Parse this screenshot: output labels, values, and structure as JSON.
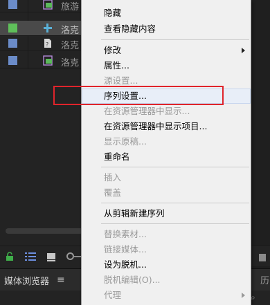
{
  "project_rows": [
    {
      "label": "旅游",
      "swatch": "#6b8cc9",
      "type": "sequence"
    },
    {
      "label": "洛克",
      "swatch": "#5fbf5a",
      "type": "multicam",
      "selected": true
    },
    {
      "label": "洛克",
      "swatch": "#6b8cc9",
      "type": "file"
    },
    {
      "label": "洛克",
      "swatch": "#6b8cc9",
      "type": "sequence"
    }
  ],
  "context_menu": {
    "items": [
      {
        "label": "隐藏",
        "enabled": true
      },
      {
        "label": "查看隐藏内容",
        "enabled": true
      },
      {
        "label": "修改",
        "enabled": true,
        "submenu": true
      },
      {
        "label": "属性...",
        "enabled": true
      },
      {
        "label": "源设置...",
        "enabled": false
      },
      {
        "label": "序列设置...",
        "enabled": true,
        "highlighted": true
      },
      {
        "label": "在资源管理器中显示...",
        "enabled": false
      },
      {
        "label": "在资源管理器中显示项目...",
        "enabled": true
      },
      {
        "label": "显示原稿...",
        "enabled": false
      },
      {
        "label": "重命名",
        "enabled": true
      },
      {
        "label": "插入",
        "enabled": false
      },
      {
        "label": "覆盖",
        "enabled": false
      },
      {
        "label": "从剪辑新建序列",
        "enabled": true
      },
      {
        "label": "替换素材...",
        "enabled": false
      },
      {
        "label": "链接媒体...",
        "enabled": false
      },
      {
        "label": "设为脱机...",
        "enabled": true
      },
      {
        "label": "脱机编辑(O)...",
        "enabled": false
      },
      {
        "label": "代理",
        "enabled": false,
        "submenu": true
      }
    ]
  },
  "bottom_panel": {
    "tab_title": "媒体浏览器",
    "right_tab_label": "历"
  },
  "colors": {
    "highlight_box": "#e0242b",
    "menu_bg": "#f0f0f0",
    "panel_bg": "#232323"
  }
}
